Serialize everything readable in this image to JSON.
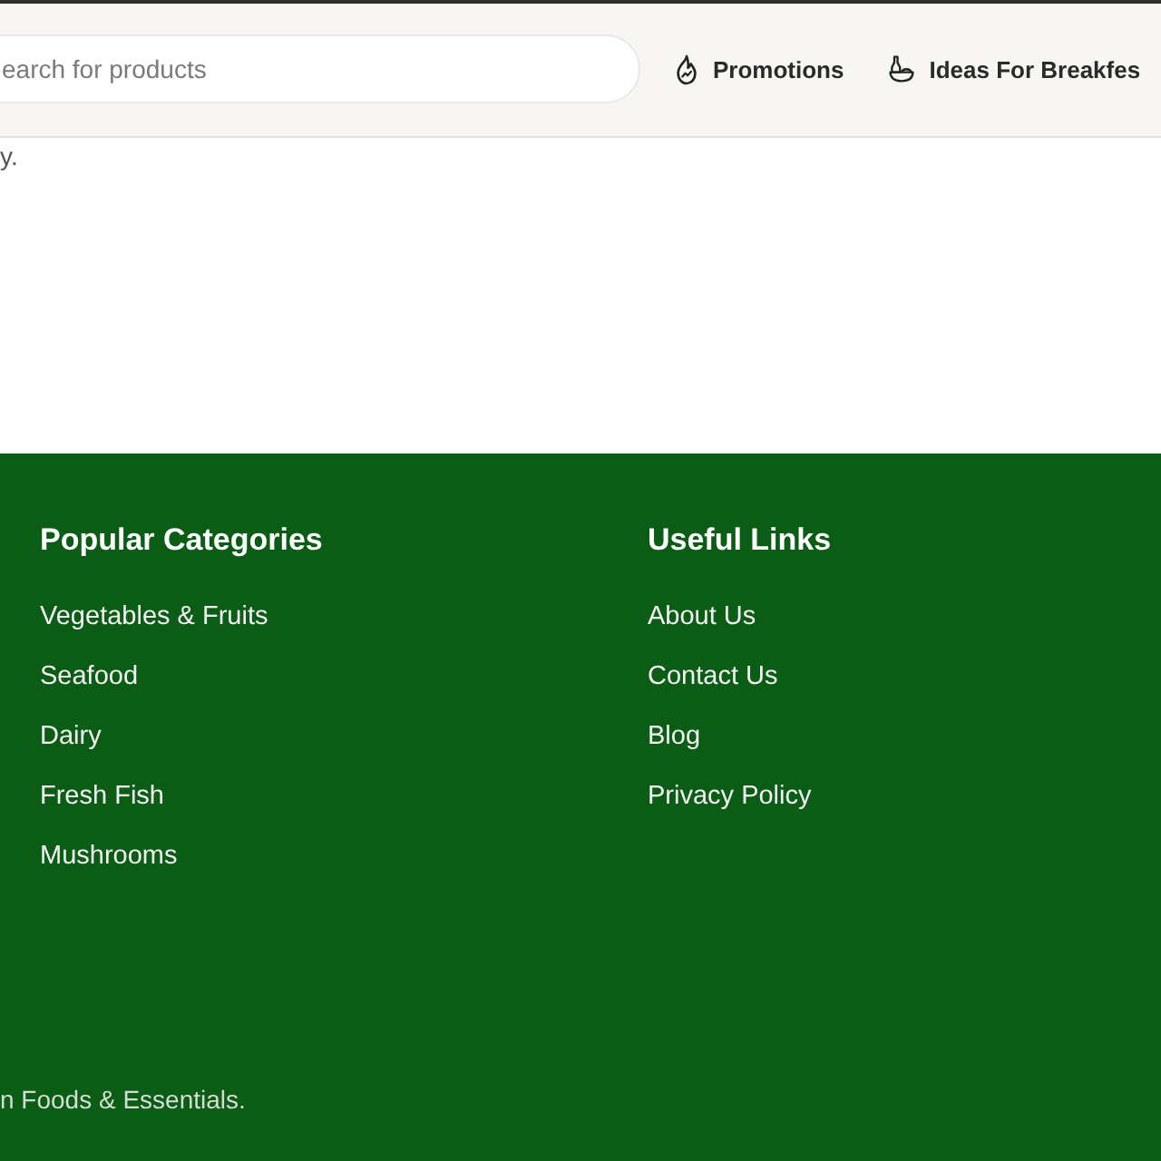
{
  "header": {
    "search": {
      "placeholder": "earch for products"
    },
    "nav": [
      {
        "label": "Promotions",
        "kind": "flame"
      },
      {
        "label": "Ideas For Breakfes",
        "kind": "bowl"
      }
    ]
  },
  "main": {
    "text": "y."
  },
  "footer": {
    "columns": [
      {
        "title": "Popular Categories",
        "links": [
          "Vegetables & Fruits",
          "Seafood",
          "Dairy",
          "Fresh Fish",
          "Mushrooms"
        ]
      },
      {
        "title": "Useful Links",
        "links": [
          "About Us",
          "Contact Us",
          "Blog",
          "Privacy Policy"
        ]
      }
    ],
    "copyright": "n Foods & Essentials."
  }
}
